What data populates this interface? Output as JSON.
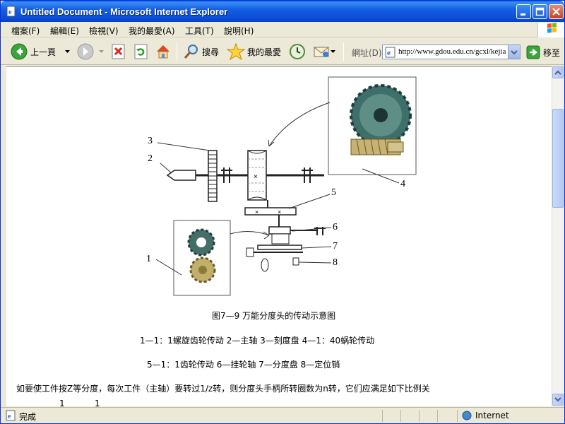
{
  "window": {
    "title": "Untitled Document - Microsoft Internet Explorer"
  },
  "menu": {
    "items": [
      "檔案(F)",
      "編輯(E)",
      "檢視(V)",
      "我的最愛(A)",
      "工具(T)",
      "說明(H)"
    ]
  },
  "toolbar": {
    "back_label": "上一頁",
    "search_label": "搜尋",
    "favorites_label": "我的最愛",
    "address_label": "網址(D)",
    "address_value": "http://www.gdou.edu.cn/gcxl/kejia",
    "go_label": "移至"
  },
  "diagram": {
    "part_labels": [
      "1",
      "2",
      "3",
      "4",
      "5",
      "6",
      "7",
      "8"
    ],
    "caption": "图7—9  万能分度头的传动示意图",
    "legend_line1": "1—1：1螺旋齿轮传动    2—主轴    3—刻度盘    4—1：40蜗轮传动",
    "legend_line2": "5—1：1齿轮传动       6—挂轮轴       7—分度盘       8—定位销"
  },
  "body_text": {
    "paragraph": "如要使工件按Z等分度，每次工件（主轴）要转过1/z转，则分度头手柄所转圈数为n转，它们应满足如下比例关",
    "fraction_1": "1",
    "fraction_2": "1"
  },
  "status": {
    "left": "完成",
    "zone": "Internet"
  }
}
